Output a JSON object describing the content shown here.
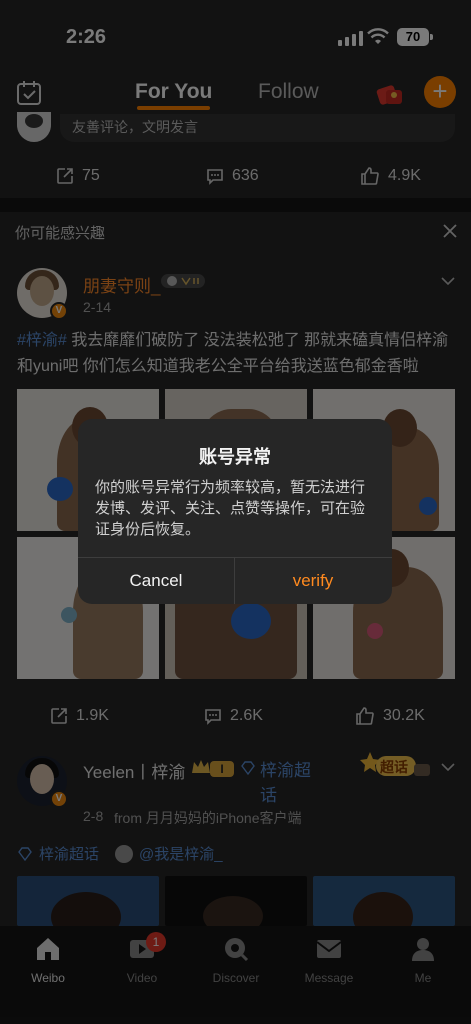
{
  "status_bar": {
    "time": "2:26",
    "battery": "70"
  },
  "top_nav": {
    "tabs": [
      {
        "label": "For You",
        "active": true
      },
      {
        "label": "Follow",
        "active": false
      }
    ]
  },
  "comment_bar": {
    "placeholder": "友善评论，文明发言"
  },
  "post0_actions": {
    "reposts": "75",
    "comments": "636",
    "likes": "4.9K"
  },
  "interest": {
    "title": "你可能感兴趣"
  },
  "post1": {
    "username": "朋妻守则_",
    "date": "2-14",
    "hashtag": "#梓渝#",
    "text": " 我去靡靡们破防了 没法装松弛了 那就来磕真情侣梓渝和yuni吧 你们怎么知道我老公全平台给我送蓝色郁金香啦",
    "actions": {
      "reposts": "1.9K",
      "comments": "2.6K",
      "likes": "30.2K"
    }
  },
  "post2": {
    "username": "Yeelen丨梓渝",
    "level_badge": "I",
    "topic": "梓渝超话",
    "date": "2-8",
    "source": "from 月月妈妈的iPhone客户端",
    "super_badge": "超话",
    "tag_supertopic": "梓渝超话",
    "tag_mention": "@我是梓渝_"
  },
  "bottom_nav": {
    "items": [
      {
        "label": "Weibo",
        "icon": "home-icon",
        "active": true
      },
      {
        "label": "Video",
        "icon": "video-icon",
        "badge": "1"
      },
      {
        "label": "Discover",
        "icon": "discover-icon"
      },
      {
        "label": "Message",
        "icon": "message-icon"
      },
      {
        "label": "Me",
        "icon": "profile-icon"
      }
    ]
  },
  "dialog": {
    "title": "账号异常",
    "message": "你的账号异常行为频率较高，暂无法进行发博、发评、关注、点赞等操作，可在验证身份后恢复。",
    "cancel_label": "Cancel",
    "verify_label": "verify"
  },
  "colors": {
    "accent": "#ff8200",
    "background": "#262626",
    "hashtag": "#5b8fd6"
  }
}
